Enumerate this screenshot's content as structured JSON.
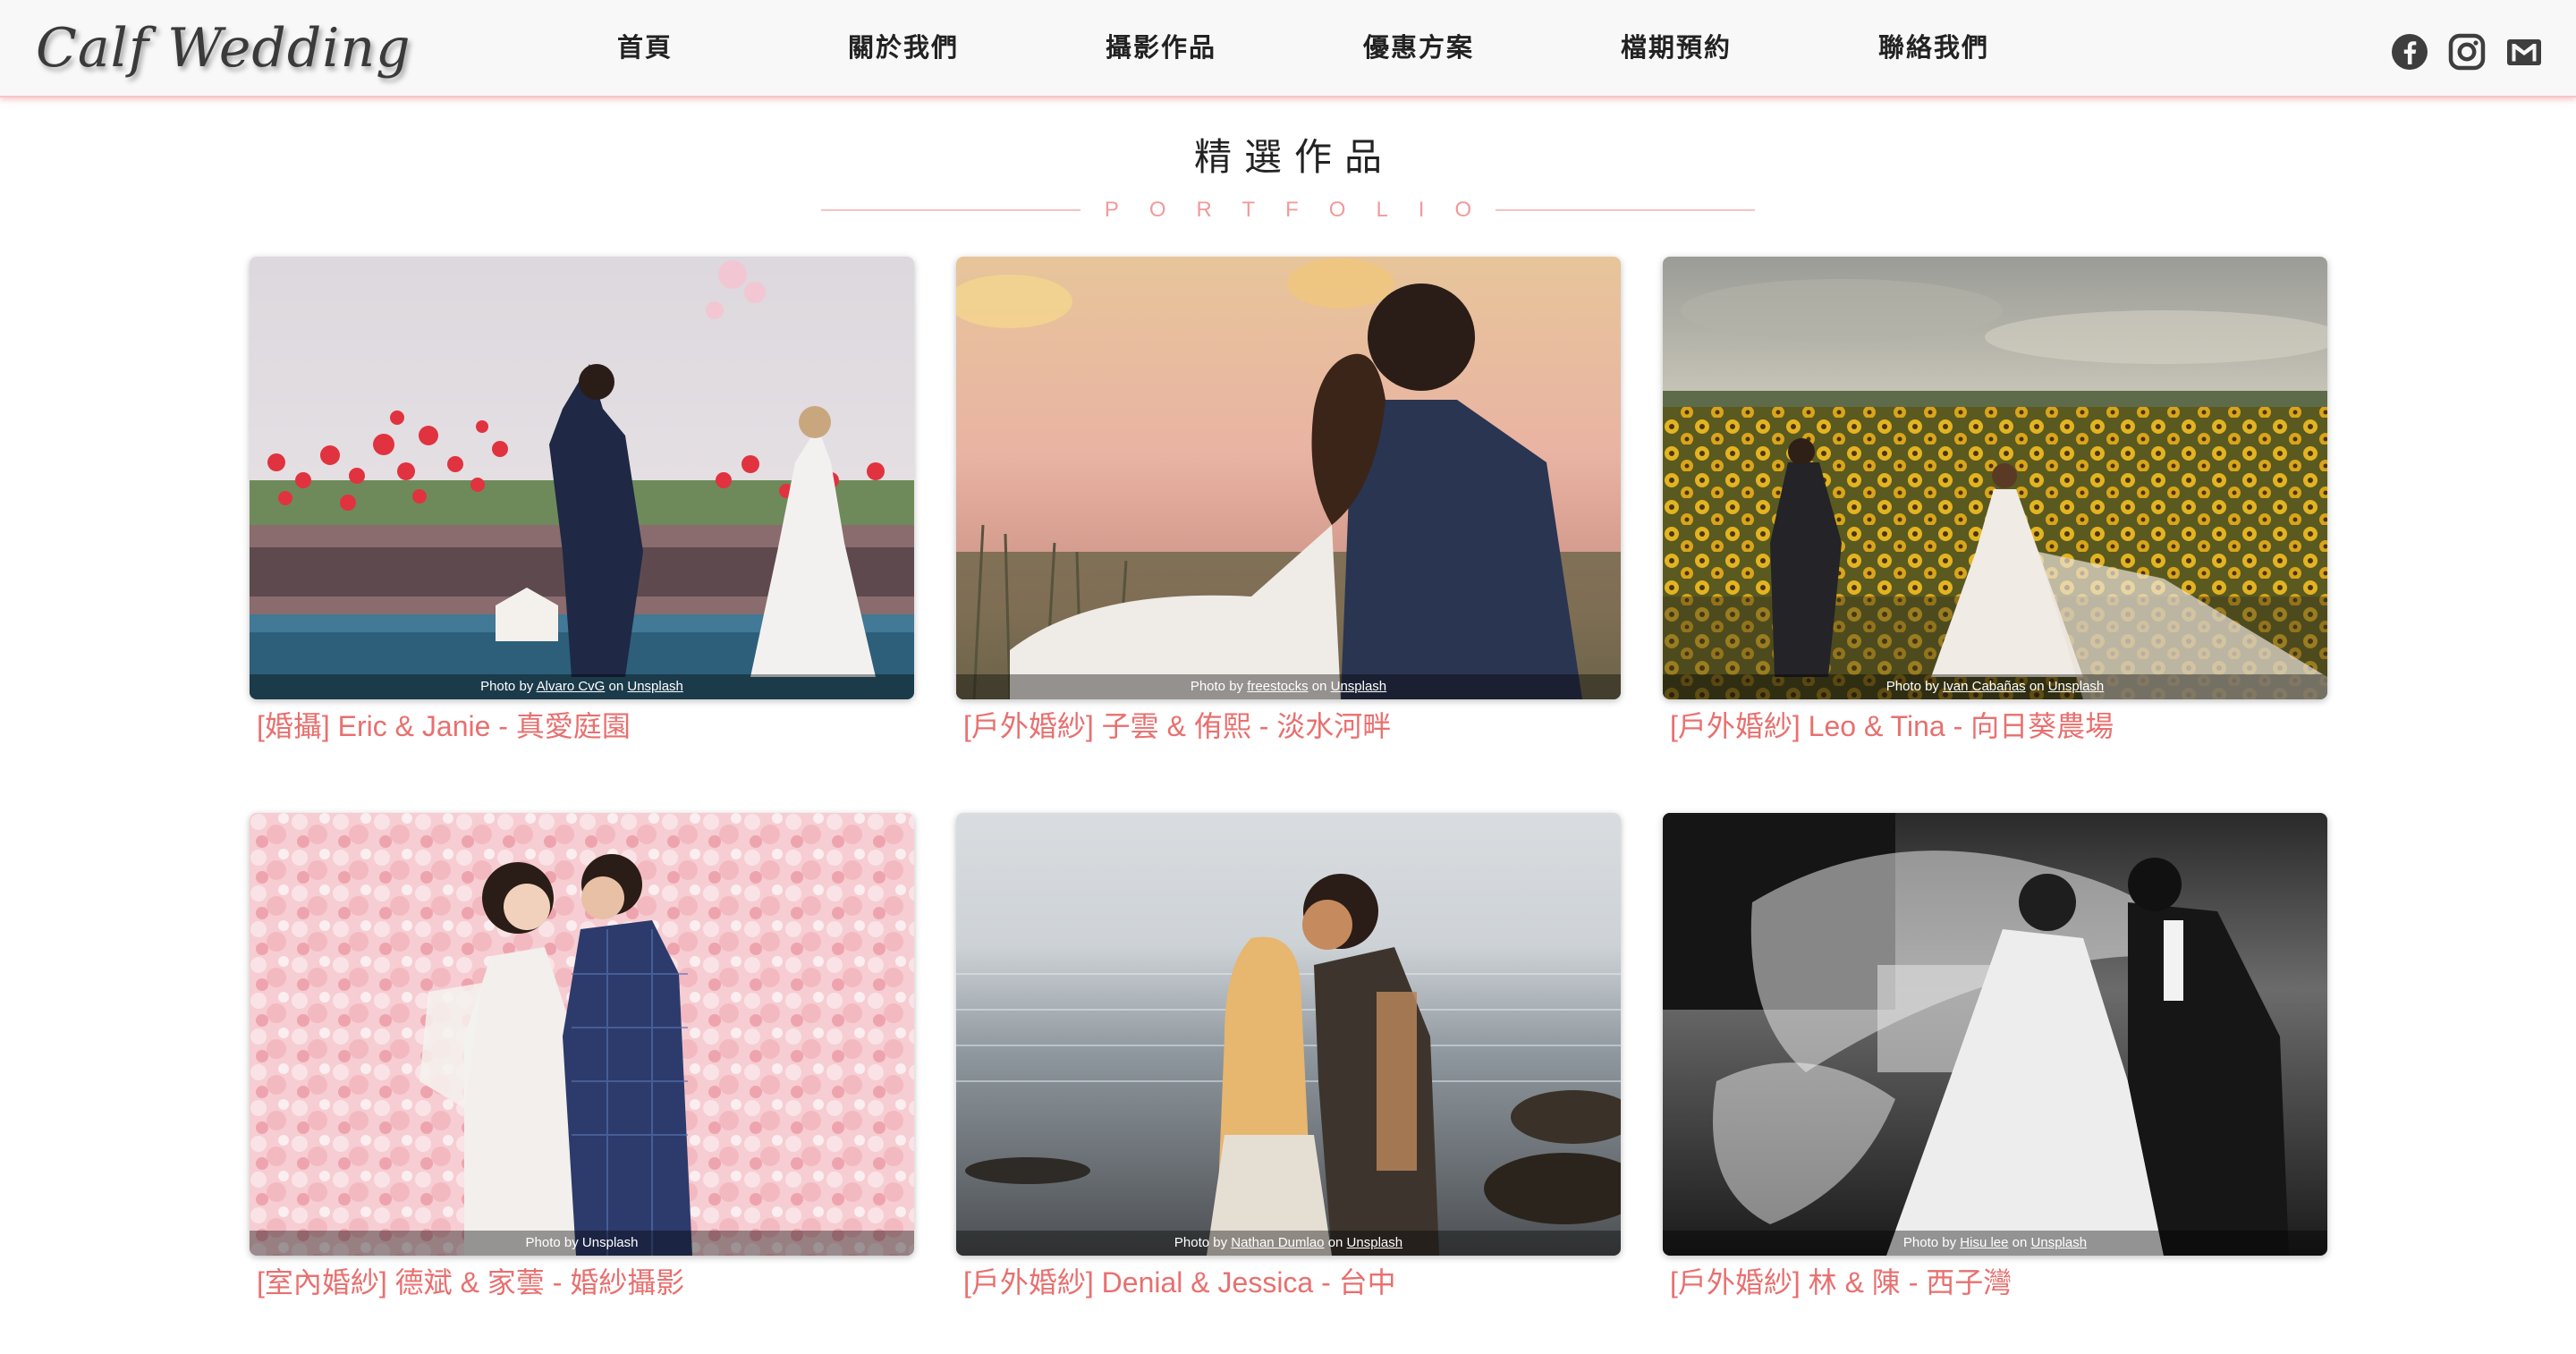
{
  "header": {
    "logo": "Calf Wedding",
    "nav": [
      "首頁",
      "關於我們",
      "攝影作品",
      "優惠方案",
      "檔期預約",
      "聯絡我們"
    ],
    "social": [
      "facebook-icon",
      "instagram-icon",
      "mail-icon"
    ]
  },
  "section": {
    "title": "精選作品",
    "subtitle": "PORTFOLIO"
  },
  "colors": {
    "accent": "#e8706f",
    "rule": "#f7c2c2",
    "header_bg": "#f8f8f8"
  },
  "cards": [
    {
      "caption": "[婚攝] Eric & Janie - 真愛庭園",
      "credit_prefix": "Photo by",
      "author": "Alvaro CvG",
      "credit_on": "on",
      "source": "Unsplash"
    },
    {
      "caption": "[戶外婚紗] 子雲 & 侑熙 - 淡水河畔",
      "credit_prefix": "Photo by",
      "author": "freestocks",
      "credit_on": "on",
      "source": "Unsplash"
    },
    {
      "caption": "[戶外婚紗] Leo & Tina - 向日葵農場",
      "credit_prefix": "Photo by",
      "author": "Ivan Cabañas",
      "credit_on": "on",
      "source": "Unsplash"
    },
    {
      "caption": "[室內婚紗] 德斌 & 家蕓 - 婚紗攝影",
      "credit_prefix": "Photo by",
      "author": "",
      "credit_on": "",
      "source": "Unsplash"
    },
    {
      "caption": "[戶外婚紗] Denial & Jessica - 台中",
      "credit_prefix": "Photo by",
      "author": "Nathan Dumlao",
      "credit_on": "on",
      "source": "Unsplash"
    },
    {
      "caption": "[戶外婚紗] 林 & 陳 - 西子灣",
      "credit_prefix": "Photo by",
      "author": "Hisu lee",
      "credit_on": "on",
      "source": "Unsplash"
    }
  ]
}
